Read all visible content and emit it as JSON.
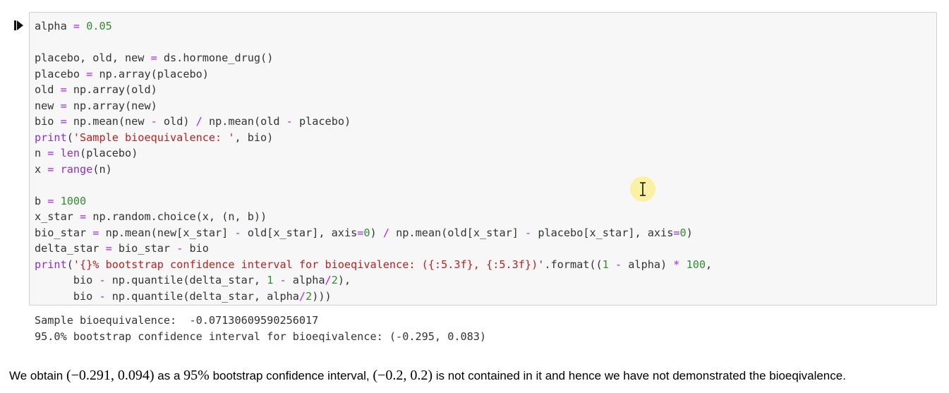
{
  "cell": {
    "run_icon": "run-cell-icon",
    "code_lines": [
      [
        {
          "t": "alpha ",
          "c": "plain"
        },
        {
          "t": "=",
          "c": "op"
        },
        {
          "t": " ",
          "c": "plain"
        },
        {
          "t": "0.05",
          "c": "num"
        }
      ],
      [],
      [
        {
          "t": "placebo, old, new ",
          "c": "plain"
        },
        {
          "t": "=",
          "c": "op"
        },
        {
          "t": " ds.hormone_drug()",
          "c": "plain"
        }
      ],
      [
        {
          "t": "placebo ",
          "c": "plain"
        },
        {
          "t": "=",
          "c": "op"
        },
        {
          "t": " np.array(placebo)",
          "c": "plain"
        }
      ],
      [
        {
          "t": "old ",
          "c": "plain"
        },
        {
          "t": "=",
          "c": "op"
        },
        {
          "t": " np.array(old)",
          "c": "plain"
        }
      ],
      [
        {
          "t": "new ",
          "c": "plain"
        },
        {
          "t": "=",
          "c": "op"
        },
        {
          "t": " np.array(new)",
          "c": "plain"
        }
      ],
      [
        {
          "t": "bio ",
          "c": "plain"
        },
        {
          "t": "=",
          "c": "op"
        },
        {
          "t": " np.mean(new ",
          "c": "plain"
        },
        {
          "t": "-",
          "c": "op"
        },
        {
          "t": " old) ",
          "c": "plain"
        },
        {
          "t": "/",
          "c": "op"
        },
        {
          "t": " np.mean(old ",
          "c": "plain"
        },
        {
          "t": "-",
          "c": "op"
        },
        {
          "t": " placebo)",
          "c": "plain"
        }
      ],
      [
        {
          "t": "print",
          "c": "builtin"
        },
        {
          "t": "(",
          "c": "plain"
        },
        {
          "t": "'Sample bioequivalence: '",
          "c": "str"
        },
        {
          "t": ", bio)",
          "c": "plain"
        }
      ],
      [
        {
          "t": "n ",
          "c": "plain"
        },
        {
          "t": "=",
          "c": "op"
        },
        {
          "t": " ",
          "c": "plain"
        },
        {
          "t": "len",
          "c": "builtin"
        },
        {
          "t": "(placebo)",
          "c": "plain"
        }
      ],
      [
        {
          "t": "x ",
          "c": "plain"
        },
        {
          "t": "=",
          "c": "op"
        },
        {
          "t": " ",
          "c": "plain"
        },
        {
          "t": "range",
          "c": "builtin"
        },
        {
          "t": "(n)",
          "c": "plain"
        }
      ],
      [],
      [
        {
          "t": "b ",
          "c": "plain"
        },
        {
          "t": "=",
          "c": "op"
        },
        {
          "t": " ",
          "c": "plain"
        },
        {
          "t": "1000",
          "c": "num"
        }
      ],
      [
        {
          "t": "x_star ",
          "c": "plain"
        },
        {
          "t": "=",
          "c": "op"
        },
        {
          "t": " np.random.choice(x, (n, b))",
          "c": "plain"
        }
      ],
      [
        {
          "t": "bio_star ",
          "c": "plain"
        },
        {
          "t": "=",
          "c": "op"
        },
        {
          "t": " np.mean(new[x_star] ",
          "c": "plain"
        },
        {
          "t": "-",
          "c": "op"
        },
        {
          "t": " old[x_star], axis",
          "c": "plain"
        },
        {
          "t": "=",
          "c": "op"
        },
        {
          "t": "0",
          "c": "num"
        },
        {
          "t": ") ",
          "c": "plain"
        },
        {
          "t": "/",
          "c": "op"
        },
        {
          "t": " np.mean(old[x_star] ",
          "c": "plain"
        },
        {
          "t": "-",
          "c": "op"
        },
        {
          "t": " placebo[x_star], axis",
          "c": "plain"
        },
        {
          "t": "=",
          "c": "op"
        },
        {
          "t": "0",
          "c": "num"
        },
        {
          "t": ")",
          "c": "plain"
        }
      ],
      [
        {
          "t": "delta_star ",
          "c": "plain"
        },
        {
          "t": "=",
          "c": "op"
        },
        {
          "t": " bio_star ",
          "c": "plain"
        },
        {
          "t": "-",
          "c": "op"
        },
        {
          "t": " bio",
          "c": "plain"
        }
      ],
      [
        {
          "t": "print",
          "c": "builtin"
        },
        {
          "t": "(",
          "c": "plain"
        },
        {
          "t": "'{}% bootstrap confidence interval for bioeqivalence: ({:5.3f}, {:5.3f})'",
          "c": "str"
        },
        {
          "t": ".format((",
          "c": "plain"
        },
        {
          "t": "1",
          "c": "num"
        },
        {
          "t": " ",
          "c": "plain"
        },
        {
          "t": "-",
          "c": "op"
        },
        {
          "t": " alpha) ",
          "c": "plain"
        },
        {
          "t": "*",
          "c": "op"
        },
        {
          "t": " ",
          "c": "plain"
        },
        {
          "t": "100",
          "c": "num"
        },
        {
          "t": ",",
          "c": "plain"
        }
      ],
      [
        {
          "t": "      bio ",
          "c": "plain"
        },
        {
          "t": "-",
          "c": "op"
        },
        {
          "t": " np.quantile(delta_star, ",
          "c": "plain"
        },
        {
          "t": "1",
          "c": "num"
        },
        {
          "t": " ",
          "c": "plain"
        },
        {
          "t": "-",
          "c": "op"
        },
        {
          "t": " alpha",
          "c": "plain"
        },
        {
          "t": "/",
          "c": "op"
        },
        {
          "t": "2",
          "c": "num"
        },
        {
          "t": "),",
          "c": "plain"
        }
      ],
      [
        {
          "t": "      bio ",
          "c": "plain"
        },
        {
          "t": "-",
          "c": "op"
        },
        {
          "t": " np.quantile(delta_star, alpha",
          "c": "plain"
        },
        {
          "t": "/",
          "c": "op"
        },
        {
          "t": "2",
          "c": "num"
        },
        {
          "t": ")))",
          "c": "plain"
        }
      ]
    ],
    "output_lines": [
      "Sample bioequivalence:  -0.07130609590256017",
      "95.0% bootstrap confidence interval for bioeqivalence: (-0.295, 0.083)"
    ]
  },
  "markdown": {
    "segments": [
      {
        "t": "We obtain ",
        "math": false
      },
      {
        "t": "(−0.291, 0.094)",
        "math": true
      },
      {
        "t": " as a ",
        "math": false
      },
      {
        "t": "95%",
        "math": true
      },
      {
        "t": " bootstrap confidence interval, ",
        "math": false
      },
      {
        "t": "(−0.2, 0.2)",
        "math": true
      },
      {
        "t": " is not contained in it and hence we have not demonstrated the bioeqivalence.",
        "math": false
      }
    ]
  },
  "colors": {
    "operator": "#aa22ff",
    "number": "#2f8f2f",
    "string": "#ba2121",
    "builtin": "#8b2fc9",
    "text": "#333333",
    "cell_background": "#f7f7f7",
    "cell_border": "#cfcfcf"
  },
  "mouse_cursor": "text-cursor-icon"
}
